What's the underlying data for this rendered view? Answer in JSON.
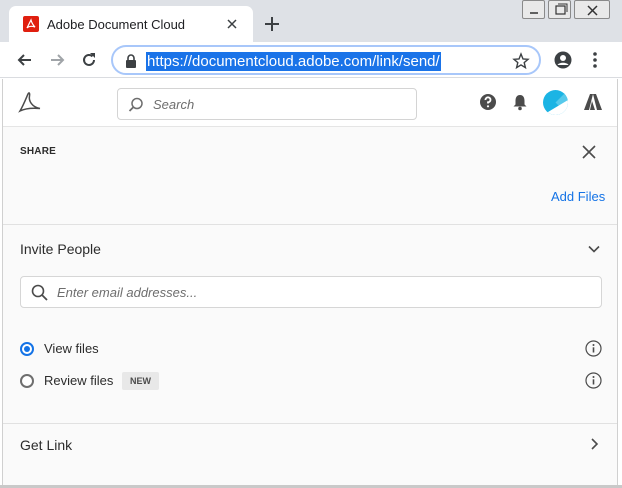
{
  "browser": {
    "tab_title": "Adobe Document Cloud",
    "url": "https://documentcloud.adobe.com/link/send/"
  },
  "header": {
    "search_placeholder": "Search"
  },
  "share": {
    "title": "SHARE",
    "add_files_label": "Add Files",
    "invite_title": "Invite People",
    "email_placeholder": "Enter email addresses...",
    "options": [
      {
        "label": "View files",
        "selected": true
      },
      {
        "label": "Review files",
        "selected": false,
        "badge": "NEW"
      }
    ],
    "get_link_label": "Get Link"
  },
  "colors": {
    "accent": "#1473e6",
    "favicon": "#e01f0f",
    "avatar": "#1bb4e4"
  },
  "icons": [
    "back-icon",
    "forward-icon",
    "reload-icon",
    "lock-icon",
    "star-icon",
    "account-icon",
    "menu-icon",
    "acrobat-logo",
    "search-icon",
    "help-icon",
    "bell-icon",
    "adobe-logo",
    "close-icon",
    "chevron-down-icon",
    "info-icon",
    "chevron-right-icon"
  ]
}
